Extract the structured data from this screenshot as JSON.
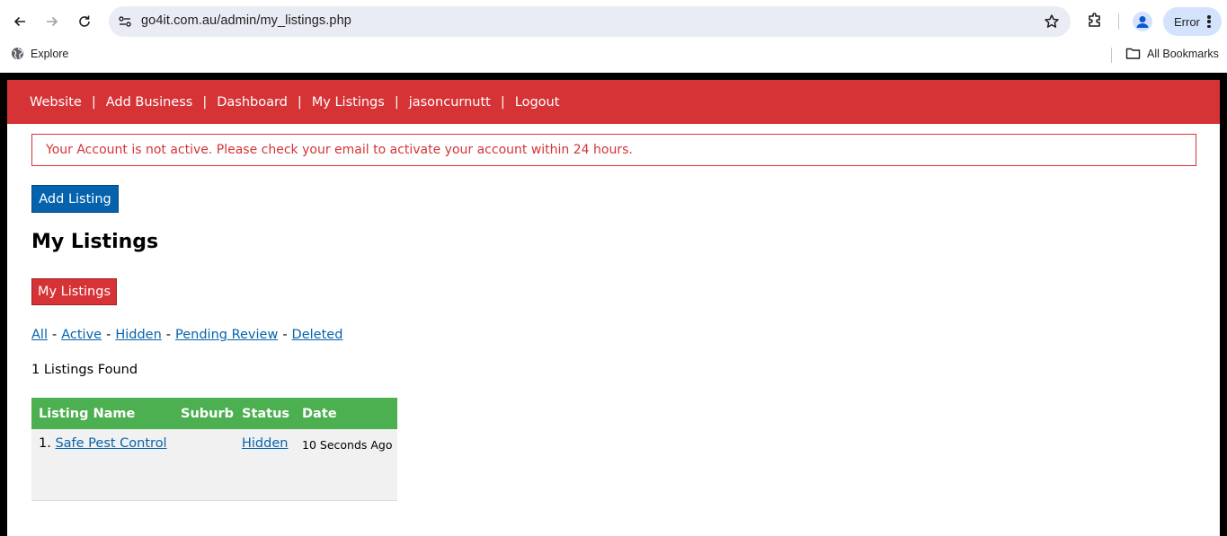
{
  "browser": {
    "url": "go4it.com.au/admin/my_listings.php",
    "profile_chip": "Error",
    "bookmarks": [
      {
        "label": "Explore",
        "icon": "globe-icon"
      },
      {
        "label": "All Bookmarks",
        "icon": "folder-icon"
      }
    ]
  },
  "nav": {
    "items": [
      {
        "label": "Website"
      },
      {
        "label": "Add Business"
      },
      {
        "label": "Dashboard"
      },
      {
        "label": "My Listings"
      },
      {
        "label": "jasoncurnutt"
      },
      {
        "label": "Logout"
      }
    ],
    "separator": "|",
    "bg_color": "#d63336"
  },
  "alert": {
    "message": "Your Account is not active. Please check your email to activate your account within 24 hours."
  },
  "actions": {
    "add_listing": "Add Listing",
    "my_listings": "My Listings"
  },
  "page": {
    "title": "My Listings"
  },
  "filters": {
    "items": [
      {
        "label": "All"
      },
      {
        "label": "Active"
      },
      {
        "label": "Hidden"
      },
      {
        "label": "Pending Review"
      },
      {
        "label": "Deleted"
      }
    ],
    "separator": "-"
  },
  "results": {
    "count_text": "1 Listings Found"
  },
  "table": {
    "columns": [
      "Listing Name",
      "Suburb",
      "Status",
      "Date"
    ],
    "rows": [
      {
        "index": "1.",
        "name": "Safe Pest Control",
        "suburb": "",
        "status": "Hidden",
        "date": "10 Seconds Ago"
      }
    ],
    "header_color": "#4caf50"
  }
}
